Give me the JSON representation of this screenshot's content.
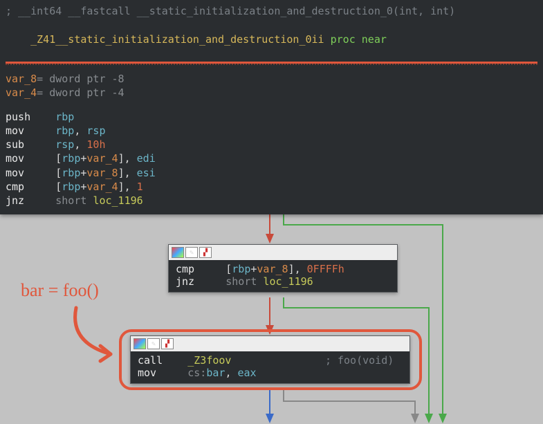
{
  "main": {
    "comment": "; __int64 __fastcall __static_initialization_and_destruction_0(int, int)",
    "label": "_Z41__static_initialization_and_destruction_0ii",
    "proc": "proc",
    "near": "near",
    "vars": [
      {
        "name": "var_8",
        "eq": "=",
        "def": "dword ptr -8"
      },
      {
        "name": "var_4",
        "eq": "=",
        "def": "dword ptr -4"
      }
    ],
    "instr": [
      {
        "m": "push",
        "ops": [
          {
            "t": "reg",
            "v": "rbp"
          }
        ]
      },
      {
        "m": "mov",
        "ops": [
          {
            "t": "reg",
            "v": "rbp"
          },
          {
            "t": "sep",
            "v": ", "
          },
          {
            "t": "reg",
            "v": "rsp"
          }
        ]
      },
      {
        "m": "sub",
        "ops": [
          {
            "t": "reg",
            "v": "rsp"
          },
          {
            "t": "sep",
            "v": ", "
          },
          {
            "t": "num",
            "v": "10h"
          }
        ]
      },
      {
        "m": "mov",
        "ops": [
          {
            "t": "txt",
            "v": "["
          },
          {
            "t": "reg",
            "v": "rbp"
          },
          {
            "t": "txt",
            "v": "+"
          },
          {
            "t": "var",
            "v": "var_4"
          },
          {
            "t": "txt",
            "v": "], "
          },
          {
            "t": "reg",
            "v": "edi"
          }
        ]
      },
      {
        "m": "mov",
        "ops": [
          {
            "t": "txt",
            "v": "["
          },
          {
            "t": "reg",
            "v": "rbp"
          },
          {
            "t": "txt",
            "v": "+"
          },
          {
            "t": "var",
            "v": "var_8"
          },
          {
            "t": "txt",
            "v": "], "
          },
          {
            "t": "reg",
            "v": "esi"
          }
        ]
      },
      {
        "m": "cmp",
        "ops": [
          {
            "t": "txt",
            "v": "["
          },
          {
            "t": "reg",
            "v": "rbp"
          },
          {
            "t": "txt",
            "v": "+"
          },
          {
            "t": "var",
            "v": "var_4"
          },
          {
            "t": "txt",
            "v": "], "
          },
          {
            "t": "num",
            "v": "1"
          }
        ]
      },
      {
        "m": "jnz",
        "ops": [
          {
            "t": "dim",
            "v": "short "
          },
          {
            "t": "loc",
            "v": "loc_1196"
          }
        ]
      }
    ]
  },
  "block2": {
    "instr": [
      {
        "m": "cmp",
        "ops": [
          {
            "t": "txt",
            "v": "["
          },
          {
            "t": "reg",
            "v": "rbp"
          },
          {
            "t": "txt",
            "v": "+"
          },
          {
            "t": "var",
            "v": "var_8"
          },
          {
            "t": "txt",
            "v": "], "
          },
          {
            "t": "num",
            "v": "0FFFFh"
          }
        ]
      },
      {
        "m": "jnz",
        "ops": [
          {
            "t": "dim",
            "v": "short "
          },
          {
            "t": "loc",
            "v": "loc_1196"
          }
        ]
      }
    ]
  },
  "block3": {
    "instr": [
      {
        "m": "call",
        "ops": [
          {
            "t": "loc",
            "v": "_Z3foov"
          }
        ],
        "comment": "; foo(void)"
      },
      {
        "m": "mov",
        "ops": [
          {
            "t": "dim",
            "v": "cs:"
          },
          {
            "t": "reg",
            "v": "bar"
          },
          {
            "t": "txt",
            "v": ", "
          },
          {
            "t": "reg",
            "v": "eax"
          }
        ]
      }
    ]
  },
  "annotation": "bar = foo()",
  "icons": {
    "color": "color-picker-icon",
    "edit": "edit-icon",
    "chart": "chart-icon"
  }
}
